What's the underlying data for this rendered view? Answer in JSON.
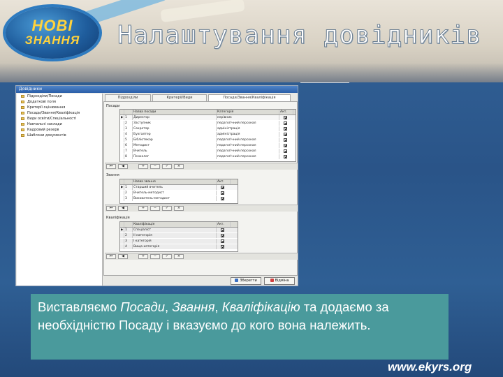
{
  "header": {
    "logo_line1": "НОВІ",
    "logo_line2": "ЗНАННЯ",
    "title": "Налаштування довідників"
  },
  "window": {
    "title": "Довідники",
    "tree": [
      "Підрозділи/Посади",
      "Додаткові поля",
      "Критерії оцінювання",
      "Посади/Звання/Кваліфікація",
      "Види освіти/Спеціальності",
      "Навчальні заклади",
      "Кадровий резерв",
      "Шаблони документів"
    ],
    "tabs": [
      "Підрозділи",
      "Критерії/Види",
      "Посади/Звання/Кваліфікація"
    ],
    "section1_label": "Посади",
    "section2_label": "Звання",
    "section3_label": "Кваліфікація",
    "col_name": "Назва посади",
    "col_group": "Категорія",
    "col_flag": "Акт.",
    "posts": [
      {
        "num": "1",
        "name": "Директор",
        "group": "керівник"
      },
      {
        "num": "2",
        "name": "Заступник",
        "group": "педагогічний персонал"
      },
      {
        "num": "3",
        "name": "Секретар",
        "group": "адміністрація"
      },
      {
        "num": "4",
        "name": "Бухгалтер",
        "group": "адміністрація"
      },
      {
        "num": "5",
        "name": "Бібліотекар",
        "group": "педагогічний персонал"
      },
      {
        "num": "6",
        "name": "Методист",
        "group": "педагогічний персонал"
      },
      {
        "num": "7",
        "name": "Вчитель",
        "group": "педагогічний персонал"
      },
      {
        "num": "8",
        "name": "Психолог",
        "group": "педагогічний персонал"
      }
    ],
    "ranks_col": "Назва звання",
    "ranks": [
      {
        "num": "1",
        "name": "Старший вчитель"
      },
      {
        "num": "2",
        "name": "Вчитель-методист"
      },
      {
        "num": "3",
        "name": "Вихователь-методист"
      }
    ],
    "quals_col": "Кваліфікація",
    "quals": [
      {
        "num": "1",
        "name": "Спеціаліст"
      },
      {
        "num": "2",
        "name": "II категорія"
      },
      {
        "num": "3",
        "name": "I категорія"
      },
      {
        "num": "4",
        "name": "Вища категорія"
      }
    ],
    "save_label": "Зберегти",
    "cancel_label": "Відміна"
  },
  "description": {
    "part1": "   Виставляємо ",
    "em1": "Посади",
    "sep1": ", ",
    "em2": "Звання",
    "sep2": ", ",
    "em3": "Кваліфікацію",
    "part2": " та додаємо за необхідністю Посаду і вказуємо до кого вона належить."
  },
  "website": "www.ekyrs.org",
  "colors": {
    "accent": "#4a9a9c",
    "background": "#2f5d92"
  }
}
